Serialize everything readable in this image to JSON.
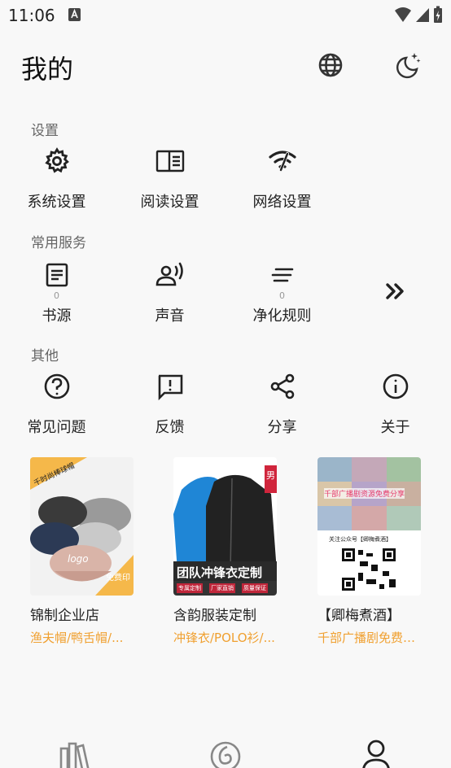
{
  "status": {
    "time": "11:06"
  },
  "header": {
    "title": "我的",
    "language_icon": "globe-icon",
    "theme_icon": "moon-icon"
  },
  "sections": {
    "settings": {
      "title": "设置",
      "items": [
        {
          "label": "系统设置",
          "icon": "gear-icon"
        },
        {
          "label": "阅读设置",
          "icon": "book-layout-icon"
        },
        {
          "label": "网络设置",
          "icon": "wifi-icon"
        }
      ]
    },
    "services": {
      "title": "常用服务",
      "items": [
        {
          "label": "书源",
          "count": "0",
          "icon": "document-icon"
        },
        {
          "label": "声音",
          "icon": "voice-icon"
        },
        {
          "label": "净化规则",
          "count": "0",
          "icon": "lines-icon"
        }
      ],
      "more_icon": "double-chevron-right-icon"
    },
    "other": {
      "title": "其他",
      "items": [
        {
          "label": "常见问题",
          "icon": "question-icon"
        },
        {
          "label": "反馈",
          "icon": "feedback-icon"
        },
        {
          "label": "分享",
          "icon": "share-icon"
        },
        {
          "label": "关于",
          "icon": "info-icon"
        }
      ]
    }
  },
  "ads": [
    {
      "name": "锦制企业店",
      "desc": "渔夫帽/鸭舌帽/...",
      "img_text_top": "千时尚棒球帽",
      "img_text_bottom": "免费印",
      "img_logo": "logo"
    },
    {
      "name": "含韵服装定制",
      "desc": "冲锋衣/POLO衫/...",
      "img_banner": "团队冲锋衣定制",
      "img_tag": "男",
      "img_sub1": "专属定制",
      "img_sub2": "厂家直销",
      "img_sub3": "质量保证"
    },
    {
      "name": "【卿梅煮酒】",
      "desc": "千部广播剧免费…",
      "img_banner": "千部广播剧资源免费分享",
      "img_caption": "关注公众号【卿梅煮酒】"
    }
  ],
  "bottom_nav": [
    {
      "icon": "bookshelf-icon"
    },
    {
      "icon": "discover-icon"
    },
    {
      "icon": "profile-icon",
      "active": true
    }
  ]
}
